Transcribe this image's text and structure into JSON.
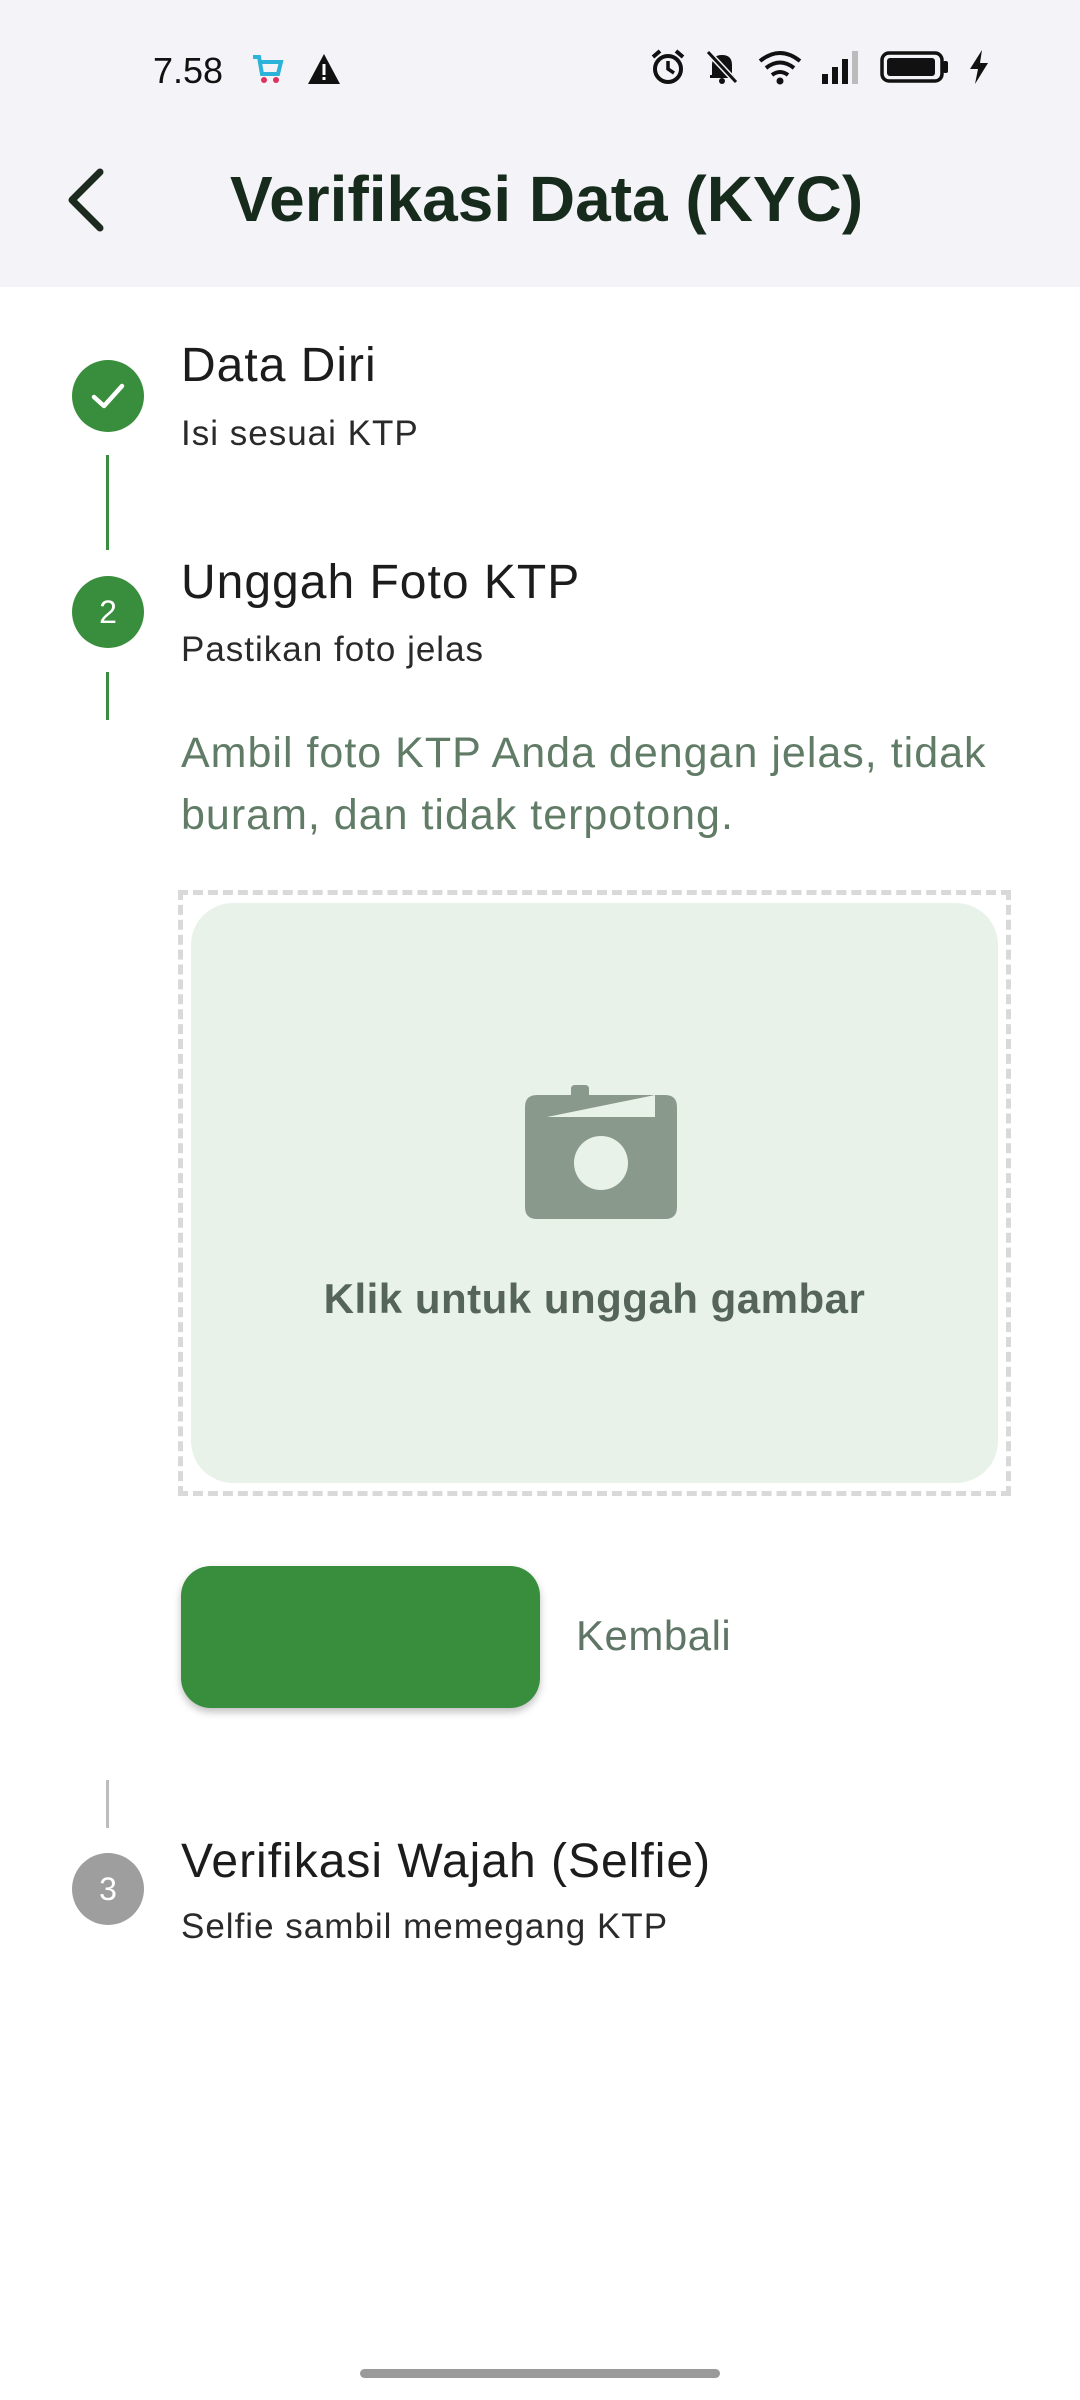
{
  "status_bar": {
    "time": "7.58",
    "icons": [
      "shopping-app-icon",
      "warning-icon",
      "alarm-icon",
      "mute-icon",
      "wifi-icon",
      "signal-icon",
      "battery-icon",
      "charging-icon"
    ]
  },
  "header": {
    "title": "Verifikasi Data (KYC)",
    "back_icon": "chevron-left-icon"
  },
  "steps": [
    {
      "number": "1",
      "state": "done",
      "title": "Data Diri",
      "subtitle": "Isi sesuai KTP"
    },
    {
      "number": "2",
      "state": "active",
      "title": "Unggah Foto KTP",
      "subtitle": "Pastikan foto jelas"
    },
    {
      "number": "3",
      "state": "inactive",
      "title": "Verifikasi Wajah (Selfie)",
      "subtitle": "Selfie sambil memegang KTP"
    }
  ],
  "step2_content": {
    "instruction": "Ambil foto KTP Anda dengan jelas, tidak buram, dan tidak terpotong.",
    "upload_label": "Klik untuk unggah gambar",
    "upload_icon": "camera-icon",
    "continue_label": "",
    "back_label": "Kembali"
  },
  "colors": {
    "primary": "#388e3c",
    "inactive": "#9e9e9e",
    "upload_bg": "#e9f2e9",
    "muted_text": "#617c66"
  }
}
